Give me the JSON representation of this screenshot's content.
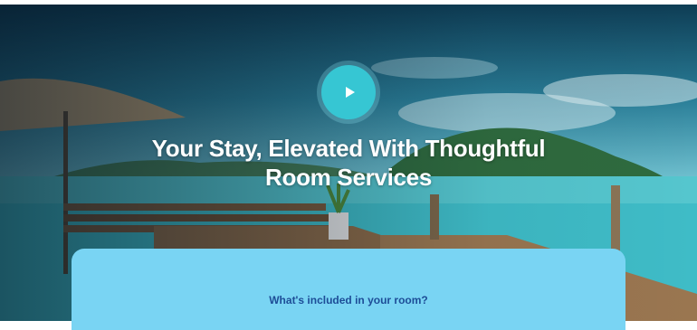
{
  "hero": {
    "title_line1": "Your Stay, Elevated With Thoughtful",
    "title_line2": "Room Services",
    "play_icon": "play-icon",
    "accent_color": "#36c6d3"
  },
  "included_card": {
    "heading": "What's included in your room?",
    "background_color": "#79d4f3",
    "heading_color": "#1d4d97"
  }
}
